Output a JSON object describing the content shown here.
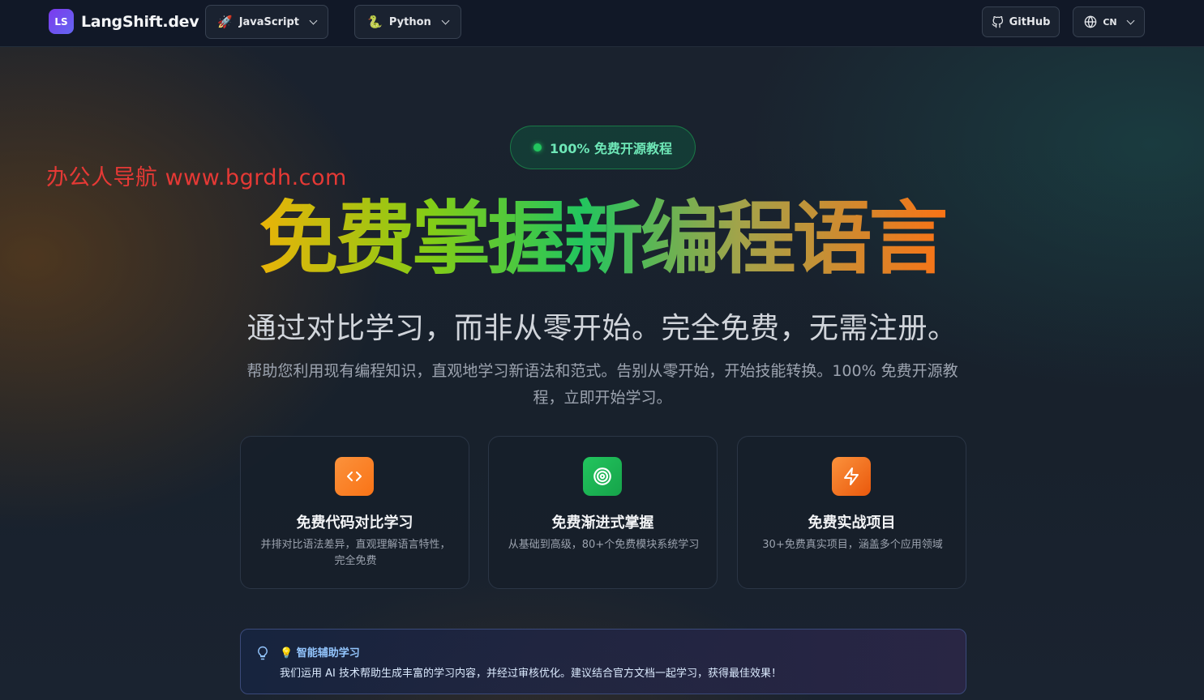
{
  "header": {
    "logo_mark": "LS",
    "logo_text": "LangShift.dev",
    "source_lang": {
      "icon": "rocket-icon",
      "label": "JavaScript"
    },
    "target_lang": {
      "icon": "snake-icon",
      "label": "Python"
    },
    "github_label": "GitHub",
    "locale_label": "CN"
  },
  "watermark": "办公人导航  www.bgrdh.com",
  "hero": {
    "badge": "100% 免费开源教程",
    "title": "免费掌握新编程语言",
    "subtitle": "通过对比学习，而非从零开始。完全免费，无需注册。",
    "description": "帮助您利用现有编程知识，直观地学习新语法和范式。告别从零开始，开始技能转换。100% 免费开源教程，立即开始学习。"
  },
  "features": [
    {
      "icon": "code-icon",
      "color": "#f97316",
      "title": "免费代码对比学习",
      "text": "并排对比语法差异，直观理解语言特性，完全免费"
    },
    {
      "icon": "target-icon",
      "color": "#22c55e",
      "title": "免费渐进式掌握",
      "text": "从基础到高级，80+个免费模块系统学习"
    },
    {
      "icon": "lightning-icon",
      "color": "#f97316",
      "title": "免费实战项目",
      "text": "30+免费真实项目，涵盖多个应用领域"
    }
  ],
  "notice": {
    "title": "💡 智能辅助学习",
    "text": "我们运用 AI 技术帮助生成丰富的学习内容，并经过审核优化。建议结合官方文档一起学习，获得最佳效果！"
  },
  "colors": {
    "accent_green": "#22c55e",
    "accent_orange": "#f97316",
    "logo_purple": "#7c3aed"
  }
}
